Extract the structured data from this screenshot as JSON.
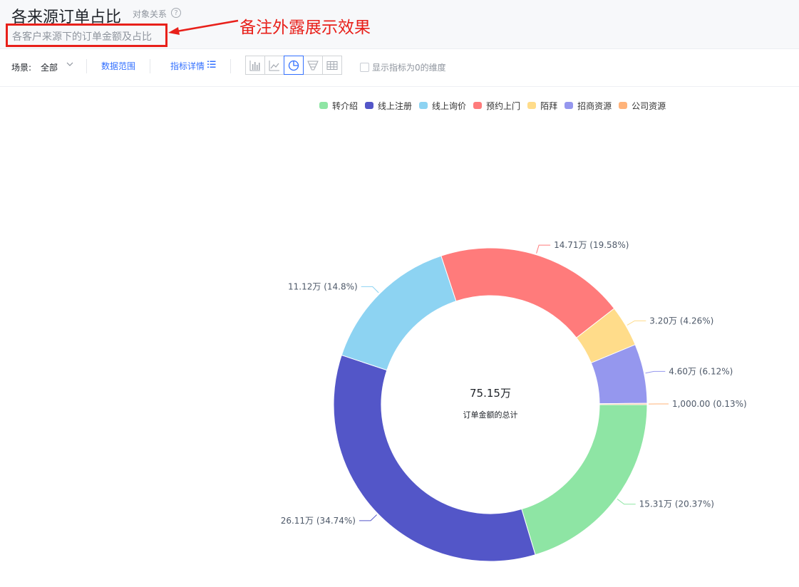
{
  "header": {
    "title": "各来源订单占比",
    "relation_link": "对象关系",
    "help_glyph": "?",
    "subtitle": "各客户来源下的订单金额及占比",
    "annotation": "备注外露展示效果"
  },
  "toolbar": {
    "scene_label": "场景:",
    "scene_value": "全部",
    "data_range": "数据范围",
    "metric_detail": "指标详情",
    "chart_types": [
      "bar-chart-icon",
      "line-chart-icon",
      "pie-chart-icon",
      "funnel-chart-icon",
      "table-icon"
    ],
    "active_chart": "pie-chart-icon",
    "show_zero_label": "显示指标为0的维度"
  },
  "chart_data": {
    "type": "pie",
    "style": "donut",
    "legend_position": "top",
    "center_value": "75.15万",
    "center_label": "订单金额的总计",
    "slices": [
      {
        "name": "转介绍",
        "value": 15.31,
        "percent": 20.37,
        "label": "15.31万 (20.37%)",
        "color": "#8ee5a4"
      },
      {
        "name": "线上注册",
        "value": 26.11,
        "percent": 34.74,
        "label": "26.11万 (34.74%)",
        "color": "#5356c8"
      },
      {
        "name": "线上询价",
        "value": 11.12,
        "percent": 14.8,
        "label": "11.12万 (14.8%)",
        "color": "#8dd3f2"
      },
      {
        "name": "预约上门",
        "value": 14.71,
        "percent": 19.58,
        "label": "14.71万 (19.58%)",
        "color": "#ff7b7b"
      },
      {
        "name": "陌拜",
        "value": 3.2,
        "percent": 4.26,
        "label": "3.20万 (4.26%)",
        "color": "#ffdc8a"
      },
      {
        "name": "招商资源",
        "value": 4.6,
        "percent": 6.12,
        "label": "4.60万 (6.12%)",
        "color": "#9597ee"
      },
      {
        "name": "公司资源",
        "value": 0.1,
        "percent": 0.13,
        "label": "1,000.00 (0.13%)",
        "color": "#ffb37a"
      }
    ]
  }
}
